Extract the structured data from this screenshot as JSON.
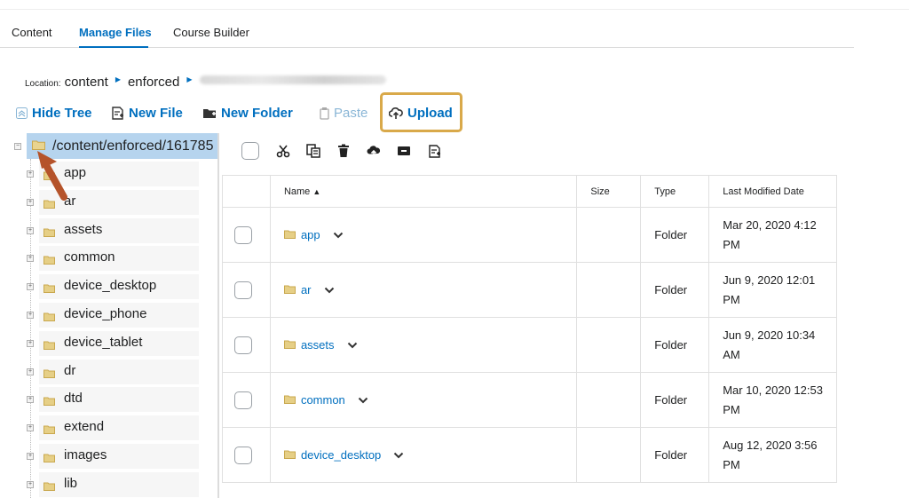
{
  "tabs": [
    {
      "label": "Content"
    },
    {
      "label": "Manage Files",
      "active": true
    },
    {
      "label": "Course Builder"
    }
  ],
  "location": {
    "label": "Location:",
    "segments": [
      "content",
      "enforced"
    ]
  },
  "toolbar": {
    "hide_tree": "Hide Tree",
    "new_file": "New File",
    "new_folder": "New Folder",
    "paste": "Paste",
    "upload": "Upload"
  },
  "tree": {
    "root": "/content/enforced/161785",
    "items": [
      "app",
      "ar",
      "assets",
      "common",
      "device_desktop",
      "device_phone",
      "device_tablet",
      "dr",
      "dtd",
      "extend",
      "images",
      "lib"
    ]
  },
  "file_actions": [
    "cut-icon",
    "copy-icon",
    "delete-icon",
    "upload-icon",
    "archive-icon",
    "new-file-icon"
  ],
  "table": {
    "headers": {
      "name": "Name",
      "size": "Size",
      "type": "Type",
      "modified": "Last Modified Date"
    },
    "rows": [
      {
        "name": "app",
        "size": "",
        "type": "Folder",
        "modified": "Mar 20, 2020 4:12 PM"
      },
      {
        "name": "ar",
        "size": "",
        "type": "Folder",
        "modified": "Jun 9, 2020 12:01 PM"
      },
      {
        "name": "assets",
        "size": "",
        "type": "Folder",
        "modified": "Jun 9, 2020 10:34 AM"
      },
      {
        "name": "common",
        "size": "",
        "type": "Folder",
        "modified": "Mar 10, 2020 12:53 PM"
      },
      {
        "name": "device_desktop",
        "size": "",
        "type": "Folder",
        "modified": "Aug 12, 2020 3:56 PM"
      }
    ]
  },
  "colors": {
    "link": "#006fbf",
    "highlight_border": "#d9a94a",
    "tree_selected": "#b6d4ee",
    "arrow": "#b5532a",
    "folder": "#d9c27a"
  }
}
